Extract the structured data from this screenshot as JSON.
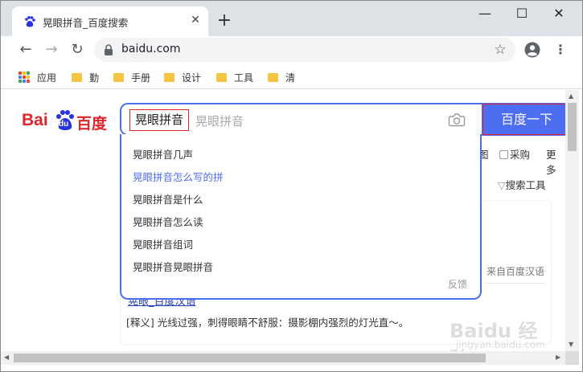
{
  "browser": {
    "tab": {
      "title": "晃眼拼音_百度搜索",
      "close": "✕"
    },
    "new_tab": "+",
    "window": {
      "minimize": "—",
      "maximize": "☐",
      "close": "✕"
    },
    "nav": {
      "back": "←",
      "forward": "→",
      "reload": "↻"
    },
    "url": "baidu.com",
    "bookmark_star": "☆",
    "menu": "⋮",
    "bookmarks": [
      "应用",
      "勤",
      "手册",
      "设计",
      "工具",
      "清"
    ]
  },
  "search": {
    "logo": {
      "left": "Bai",
      "right": "百度",
      "paw": "du"
    },
    "query": "晃眼拼音",
    "hint": "晃眼拼音",
    "button": "百度一下",
    "suggestions": [
      "晃眼拼音几声",
      "晃眼拼音怎么写的拼",
      "晃眼拼音是什么",
      "晃眼拼音怎么读",
      "晃眼拼音组词",
      "晃眼拼音晃眼拼音"
    ],
    "highlighted_index": 1,
    "feedback": "反馈"
  },
  "background": {
    "tab_suffix_1": "图",
    "tab_purchase": "采购",
    "tab_more": "更多",
    "tools": "搜索工具",
    "source_note": "来自百度汉语",
    "cut_title": "晃眼_百度汉语",
    "definition": "[释义] 光线过强，刺得眼睛不舒服：摄影棚内强烈的灯光直～。"
  },
  "watermark": {
    "text": "Baidu 经验",
    "sub": "jingyan.baidu.com"
  },
  "colors": {
    "accent": "#4e6ef2",
    "highlight_box": "#e0252a",
    "logo_red": "#e0252a",
    "logo_blue": "#2932e1"
  }
}
